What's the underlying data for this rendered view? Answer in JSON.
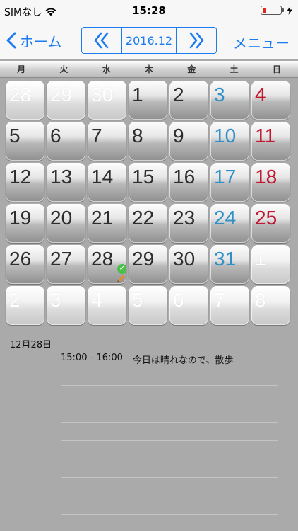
{
  "status": {
    "carrier": "SIMなし",
    "time": "15:28",
    "battery_color": "#e0261f"
  },
  "nav": {
    "back_label": "ホーム",
    "month": "2016.12",
    "menu_label": "メニュー",
    "accent": "#1a7cf0",
    "prev_icon": "double-chevron-left-icon",
    "next_icon": "double-chevron-right-icon"
  },
  "weekdays": [
    "月",
    "火",
    "水",
    "木",
    "金",
    "土",
    "日"
  ],
  "weeks": [
    [
      {
        "d": "28",
        "t": "other"
      },
      {
        "d": "29",
        "t": "other"
      },
      {
        "d": "30",
        "t": "other"
      },
      {
        "d": "1",
        "t": ""
      },
      {
        "d": "2",
        "t": ""
      },
      {
        "d": "3",
        "t": "sat"
      },
      {
        "d": "4",
        "t": "sun"
      }
    ],
    [
      {
        "d": "5",
        "t": ""
      },
      {
        "d": "6",
        "t": ""
      },
      {
        "d": "7",
        "t": ""
      },
      {
        "d": "8",
        "t": ""
      },
      {
        "d": "9",
        "t": ""
      },
      {
        "d": "10",
        "t": "sat"
      },
      {
        "d": "11",
        "t": "sun"
      }
    ],
    [
      {
        "d": "12",
        "t": ""
      },
      {
        "d": "13",
        "t": ""
      },
      {
        "d": "14",
        "t": ""
      },
      {
        "d": "15",
        "t": ""
      },
      {
        "d": "16",
        "t": ""
      },
      {
        "d": "17",
        "t": "sat"
      },
      {
        "d": "18",
        "t": "sun"
      }
    ],
    [
      {
        "d": "19",
        "t": ""
      },
      {
        "d": "20",
        "t": ""
      },
      {
        "d": "21",
        "t": ""
      },
      {
        "d": "22",
        "t": ""
      },
      {
        "d": "23",
        "t": ""
      },
      {
        "d": "24",
        "t": "sat"
      },
      {
        "d": "25",
        "t": "sun"
      }
    ],
    [
      {
        "d": "26",
        "t": ""
      },
      {
        "d": "27",
        "t": ""
      },
      {
        "d": "28",
        "t": "",
        "mark": true
      },
      {
        "d": "29",
        "t": ""
      },
      {
        "d": "30",
        "t": ""
      },
      {
        "d": "31",
        "t": "sat"
      },
      {
        "d": "1",
        "t": "other"
      }
    ],
    [
      {
        "d": "2",
        "t": "other"
      },
      {
        "d": "3",
        "t": "other"
      },
      {
        "d": "4",
        "t": "other"
      },
      {
        "d": "5",
        "t": "other"
      },
      {
        "d": "6",
        "t": "other"
      },
      {
        "d": "7",
        "t": "other"
      },
      {
        "d": "8",
        "t": "other"
      }
    ]
  ],
  "events": {
    "date": "12月28日",
    "items": [
      {
        "time": "15:00 - 16:00",
        "title": "今日は晴れなので、散歩"
      }
    ]
  }
}
